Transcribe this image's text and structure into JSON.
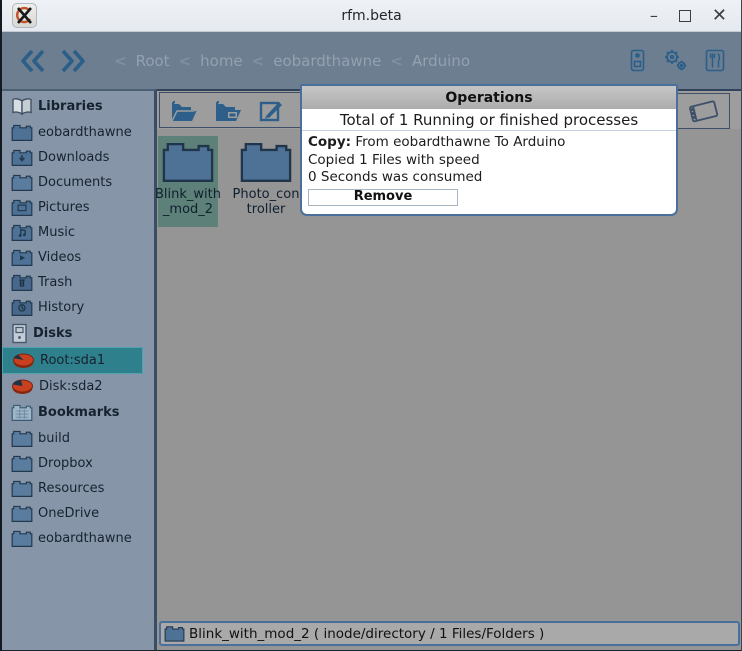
{
  "window": {
    "title": "rfm.beta",
    "controls": {
      "minimize_glyph": "–",
      "close_glyph": "✕"
    }
  },
  "breadcrumb": {
    "separator": "<",
    "items": [
      "Root",
      "home",
      "eobardthawne",
      "Arduino"
    ]
  },
  "top_toolbar_icons": [
    "nav-back-icon",
    "nav-forward-icon",
    "device-icon",
    "gears-icon",
    "utensils-icon"
  ],
  "pane_toolbar_icons": [
    "folder-open-icon",
    "folder-copy-icon",
    "edit-icon",
    "trash-icon",
    "tilted-card-icon"
  ],
  "sidebar": {
    "sections": [
      {
        "header": "Libraries",
        "items": [
          "eobardthawne",
          "Downloads",
          "Documents",
          "Pictures",
          "Music",
          "Videos",
          "Trash",
          "History"
        ]
      },
      {
        "header": "Disks",
        "items": [
          "Root:sda1",
          "Disk:sda2"
        ],
        "selected": "Root:sda1"
      },
      {
        "header": "Bookmarks",
        "items": [
          "build",
          "Dropbox",
          "Resources",
          "OneDrive",
          "eobardthawne"
        ]
      }
    ]
  },
  "main": {
    "files": [
      {
        "name": "Blink_with_mod_2",
        "line1": "Blink_with",
        "line2": "_mod_2",
        "selected": true
      },
      {
        "name": "Photo_controller",
        "line1": "Photo_con",
        "line2": "troller",
        "selected": false
      }
    ],
    "status": "Blink_with_mod_2 ( inode/directory / 1 Files/Folders )"
  },
  "dialog": {
    "title": "Operations",
    "summary": "Total of 1 Running or finished processes",
    "copy_label": "Copy:",
    "copy_text": "From eobardthawne To Arduino",
    "line2": "Copied 1 Files with speed",
    "line3": "0 Seconds was consumed",
    "remove_button": "Remove"
  },
  "colors": {
    "toolbar_bg": "#6d7e91",
    "sidebar_bg": "#8696a8",
    "main_bg": "#959595",
    "selection_teal": "#2e808c",
    "tile_selection": "#5d8178",
    "folder_blue": "#4e7296",
    "disk_red": "#c8401e",
    "dialog_border": "#4a6f9d",
    "icon_steel": "#2e5f8a"
  }
}
